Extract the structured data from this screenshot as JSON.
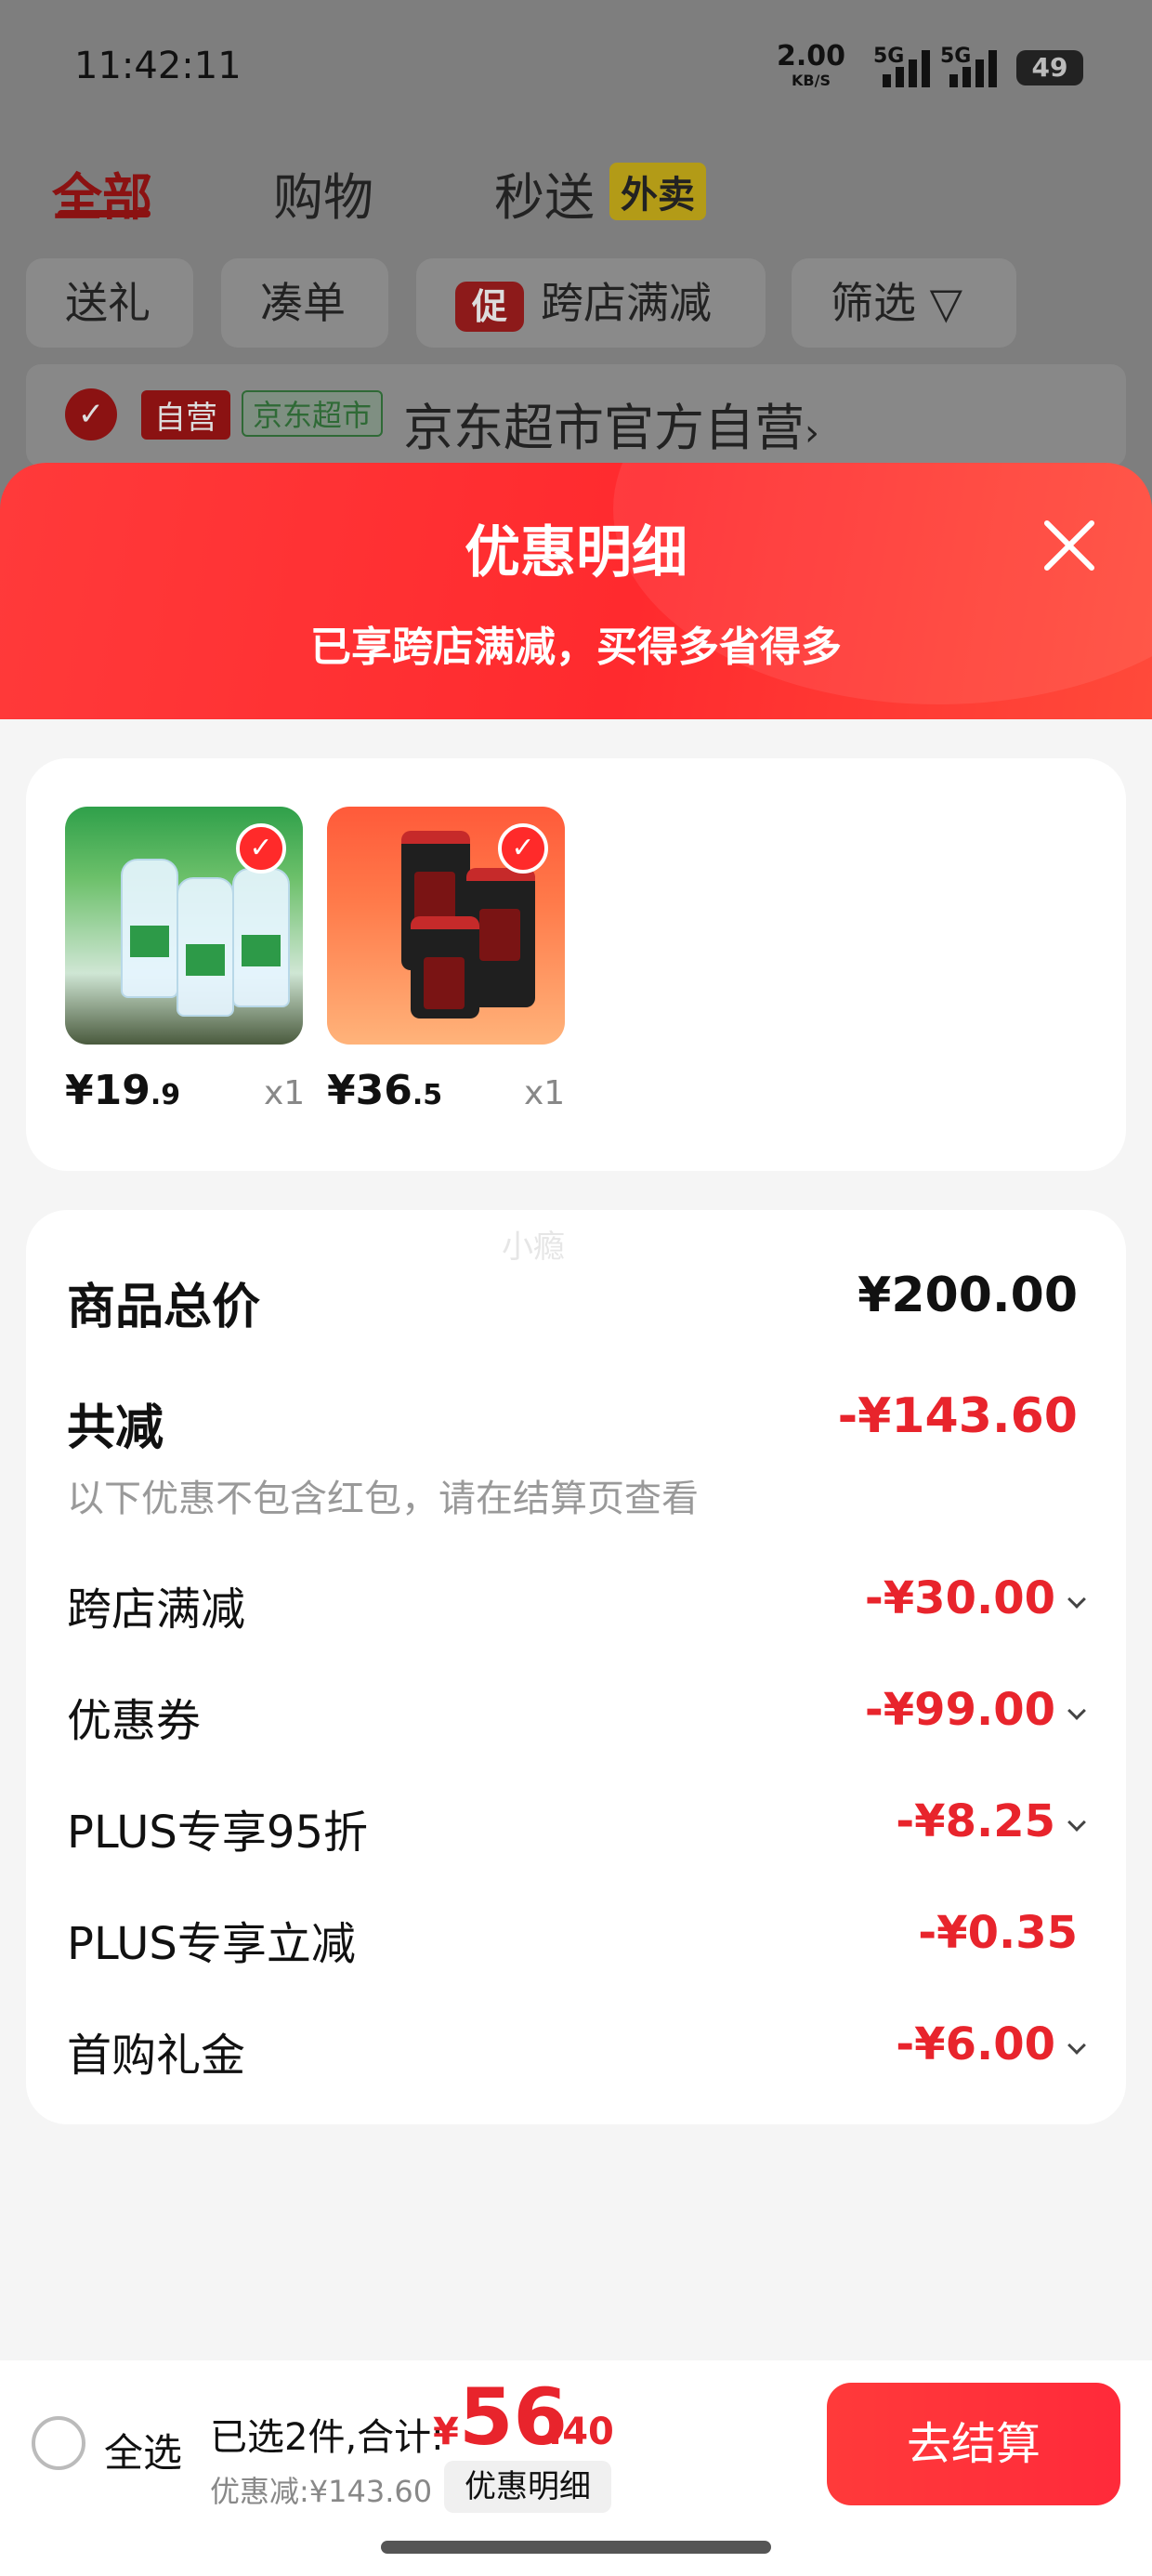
{
  "status_bar": {
    "time": "11:42:11",
    "net_speed": "2.00",
    "net_unit": "KB/S",
    "sig1": "5G",
    "sig2": "5G",
    "battery": "49"
  },
  "top_tabs": {
    "all": "全部",
    "shopping": "购物",
    "instant": "秒送",
    "takeout": "外卖"
  },
  "filter_chips": [
    "送礼",
    "凑单",
    "跨店满减",
    "筛选"
  ],
  "promo_badge": "促",
  "store": {
    "self_run": "自营",
    "supermarket": "京东超市",
    "name": "京东超市官方自营",
    "arrow": "›"
  },
  "sheet": {
    "title": "优惠明细",
    "subtitle": "已享跨店满减，买得多省得多"
  },
  "products": [
    {
      "price_main": "¥19",
      "price_dec": ".9",
      "qty": "x1"
    },
    {
      "price_main": "¥36",
      "price_dec": ".5",
      "qty": "x1"
    }
  ],
  "watermark": "小瘾",
  "breakdown": {
    "total_label": "商品总价",
    "total_value": "¥200.00",
    "reduce_label": "共减",
    "reduce_value": "-¥143.60",
    "note": "以下优惠不包含红包，请在结算页查看",
    "items": [
      {
        "label": "跨店满减",
        "value": "-¥30.00"
      },
      {
        "label": "优惠券",
        "value": "-¥99.00"
      },
      {
        "label": "PLUS专享95折",
        "value": "-¥8.25"
      },
      {
        "label": "PLUS专享立减",
        "value": "-¥0.35"
      },
      {
        "label": "首购礼金",
        "value": "-¥6.00"
      }
    ]
  },
  "bottom": {
    "select_all": "全选",
    "selected_text": "已选2件,合计:",
    "yen": "¥",
    "total_int": "56",
    "total_dec": ".40",
    "discount": "优惠减:¥143.60",
    "detail_button": "优惠明细",
    "checkout": "去结算"
  },
  "colors": {
    "accent": "#e8242c",
    "sheet_red": "#ff2a2e"
  }
}
